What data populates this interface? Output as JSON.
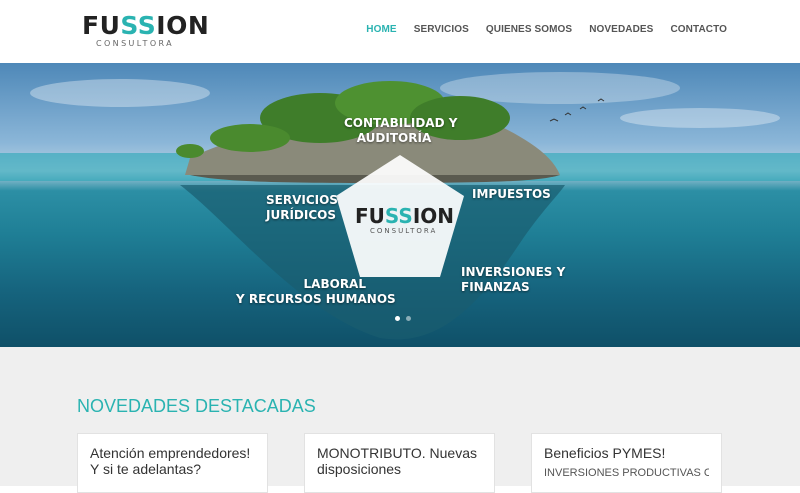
{
  "brand": {
    "logo_main_pre": "FU",
    "logo_main_mid": "SS",
    "logo_main_post": "ION",
    "logo_sub": "CONSULTORA",
    "accent": "#2ab3b1"
  },
  "nav": {
    "items": [
      {
        "label": "HOME",
        "active": true
      },
      {
        "label": "SERVICIOS",
        "active": false
      },
      {
        "label": "QUIENES SOMOS",
        "active": false
      },
      {
        "label": "NOVEDADES",
        "active": false
      },
      {
        "label": "CONTACTO",
        "active": false
      }
    ]
  },
  "hero": {
    "labels": {
      "contabilidad_1": "CONTABILIDAD Y",
      "contabilidad_2": "AUDITORÍA",
      "servicios_1": "SERVICIOS",
      "servicios_2": "JURÍDICOS",
      "impuestos": "IMPUESTOS",
      "inversiones_1": "INVERSIONES Y",
      "inversiones_2": "FINANZAS",
      "laboral_1": "LABORAL",
      "laboral_2": "Y RECURSOS HUMANOS"
    },
    "center_logo_pre": "FU",
    "center_logo_mid": "SS",
    "center_logo_post": "ION",
    "center_logo_sub": "CONSULTORA",
    "slides": [
      {
        "active": true
      },
      {
        "active": false
      }
    ]
  },
  "section": {
    "title": "NOVEDADES DESTACADAS",
    "cards": [
      {
        "title": "Atención emprendedores! Y si te adelantas?",
        "text": ""
      },
      {
        "title": "MONOTRIBUTO. Nuevas disposiciones",
        "text": ""
      },
      {
        "title": "Beneficios PYMES!",
        "text": "INVERSIONES PRODUCTIVAS Con"
      }
    ]
  }
}
